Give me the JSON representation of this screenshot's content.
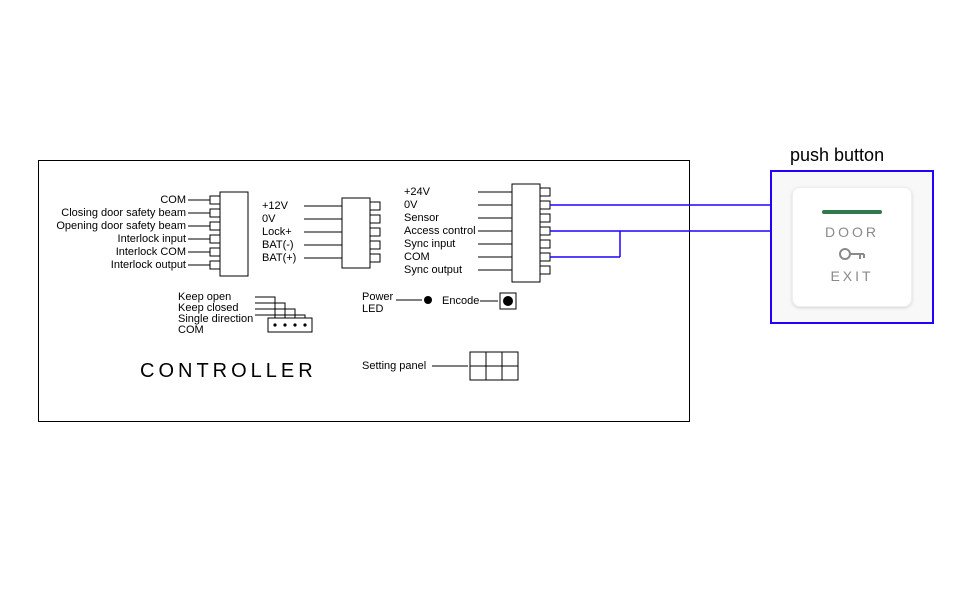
{
  "title": "CONTROLLER",
  "push_button_title": "push button",
  "push_button": {
    "line1": "DOOR",
    "line2": "EXIT"
  },
  "block1_labels": [
    "COM",
    "Closing door safety beam",
    "Opening door safety beam",
    "Interlock input",
    "Interlock COM",
    "Interlock output"
  ],
  "block2_labels": [
    "+12V",
    "0V",
    "Lock+",
    "BAT(-)",
    "BAT(+)"
  ],
  "block3_labels": [
    "+24V",
    "0V",
    "Sensor",
    "Access control",
    "Sync input",
    "COM",
    "Sync output"
  ],
  "block4_labels": [
    "Keep open",
    "Keep closed",
    "Single direction",
    "COM"
  ],
  "power_label": "Power",
  "led_label": "LED",
  "encode_label": "Encode",
  "setting_panel_label": "Setting panel"
}
